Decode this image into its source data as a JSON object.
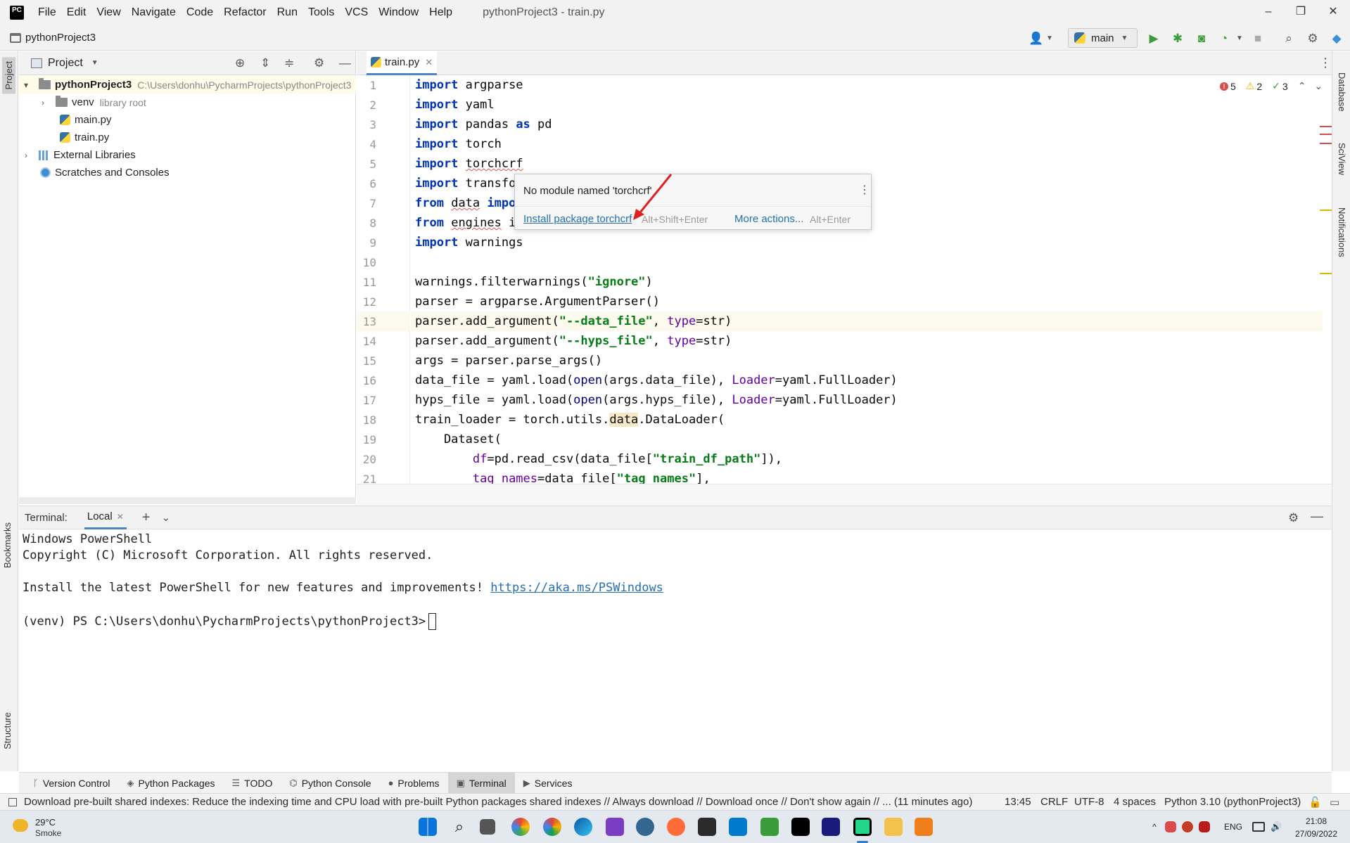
{
  "window": {
    "title": "pythonProject3 - train.py",
    "menu": [
      "File",
      "Edit",
      "View",
      "Navigate",
      "Code",
      "Refactor",
      "Run",
      "Tools",
      "VCS",
      "Window",
      "Help"
    ],
    "controls": {
      "minimize": "–",
      "maximize": "❐",
      "close": "✕"
    }
  },
  "navbar": {
    "project": "pythonProject3",
    "run_config": "main"
  },
  "left_strip": {
    "project": "Project",
    "bookmarks": "Bookmarks",
    "structure": "Structure"
  },
  "right_strip": {
    "database": "Database",
    "sciview": "SciView",
    "notifications": "Notifications"
  },
  "project_panel": {
    "title": "Project",
    "tree": [
      {
        "name": "pythonProject3",
        "hint": "C:\\Users\\donhu\\PycharmProjects\\pythonProject3"
      },
      {
        "name": "venv",
        "hint": "library root"
      },
      {
        "name": "main.py"
      },
      {
        "name": "train.py"
      },
      {
        "name": "External Libraries"
      },
      {
        "name": "Scratches and Consoles"
      }
    ]
  },
  "editor": {
    "tab": "train.py",
    "inspections": {
      "errors": "5",
      "warnings": "2",
      "weak": "3"
    },
    "line_numbers": [
      "1",
      "2",
      "3",
      "4",
      "5",
      "6",
      "7",
      "8",
      "9",
      "10",
      "11",
      "12",
      "13",
      "14",
      "15",
      "16",
      "17",
      "18",
      "19",
      "20",
      "21"
    ],
    "current_line": 13,
    "code": {
      "l1_kw": "import",
      "l1": " argparse",
      "l2_kw": "import",
      "l2": " yaml",
      "l3_kw": "import",
      "l3a": " pandas ",
      "l3_as": "as",
      "l3b": " pd",
      "l4_kw": "import",
      "l4": " torch",
      "l5_kw": "import",
      "l5": "torchcrf",
      "l6_kw": "import",
      "l6": " transfo",
      "l7_kw": "from",
      "l7": "data",
      "l7_kw2": " impo",
      "l8_kw": "from",
      "l8": "engines",
      "l8b": " i",
      "l9_kw": "import",
      "l9": " warnings",
      "l11a": "warnings.filterwarnings(",
      "l11s": "\"ignore\"",
      "l11b": ")",
      "l12": "parser = argparse.ArgumentParser()",
      "l13a": "parser.add_argument(",
      "l13s": "\"--data_file\"",
      "l13c": ", ",
      "l13p": "type",
      "l13d": "=str)",
      "l14a": "parser.add_argument(",
      "l14s": "\"--hyps_file\"",
      "l14c": ", ",
      "l14p": "type",
      "l14d": "=str)",
      "l15": "args = parser.parse_args()",
      "l16a": "data_file = yaml.load(",
      "l16b": "open",
      "l16c": "(args.data_file), ",
      "l16p": "Loader",
      "l16d": "=yaml.FullLoader)",
      "l17a": "hyps_file = yaml.load(",
      "l17b": "open",
      "l17c": "(args.hyps_file), ",
      "l17p": "Loader",
      "l17d": "=yaml.FullLoader)",
      "l18a": "train_loader = torch.utils.",
      "l18h": "data",
      "l18b": ".DataLoader(",
      "l19": "    Dataset(",
      "l20p": "df",
      "l20a": "=pd.read_csv(data_file[",
      "l20s": "\"train_df_path\"",
      "l20b": "]),",
      "l21p1": "tag_names",
      "l21a": "=data_file[",
      "l21s": "\"tag_names\"",
      "l21b": "],"
    }
  },
  "popup": {
    "message": "No module named 'torchcrf'",
    "install": "Install package torchcrf",
    "install_shortcut": "Alt+Shift+Enter",
    "more": "More actions...",
    "more_shortcut": "Alt+Enter"
  },
  "terminal": {
    "label": "Terminal:",
    "tab": "Local",
    "lines": {
      "l1": "Windows PowerShell",
      "l2": "Copyright (C) Microsoft Corporation. All rights reserved.",
      "l3": "Install the latest PowerShell for new features and improvements! ",
      "l3_link": "https://aka.ms/PSWindows",
      "prompt": "(venv) PS C:\\Users\\donhu\\PycharmProjects\\pythonProject3>"
    }
  },
  "tool_windows": [
    "Version Control",
    "Python Packages",
    "TODO",
    "Python Console",
    "Problems",
    "Terminal",
    "Services"
  ],
  "statusbar": {
    "message": "Download pre-built shared indexes: Reduce the indexing time and CPU load with pre-built Python packages shared indexes // Always download // Download once // Don't show again // ... (11 minutes ago)",
    "position": "13:45",
    "line_sep": "CRLF",
    "encoding": "UTF-8",
    "indent": "4 spaces",
    "interpreter": "Python 3.10 (pythonProject3)"
  },
  "taskbar": {
    "temp": "29°C",
    "weather": "Smoke",
    "lang": "ENG",
    "time": "21:08",
    "date": "27/09/2022"
  },
  "colors": {
    "accent": "#4a86c7",
    "error": "#d94c4c",
    "warning": "#e2b500",
    "link": "#2470b3"
  }
}
